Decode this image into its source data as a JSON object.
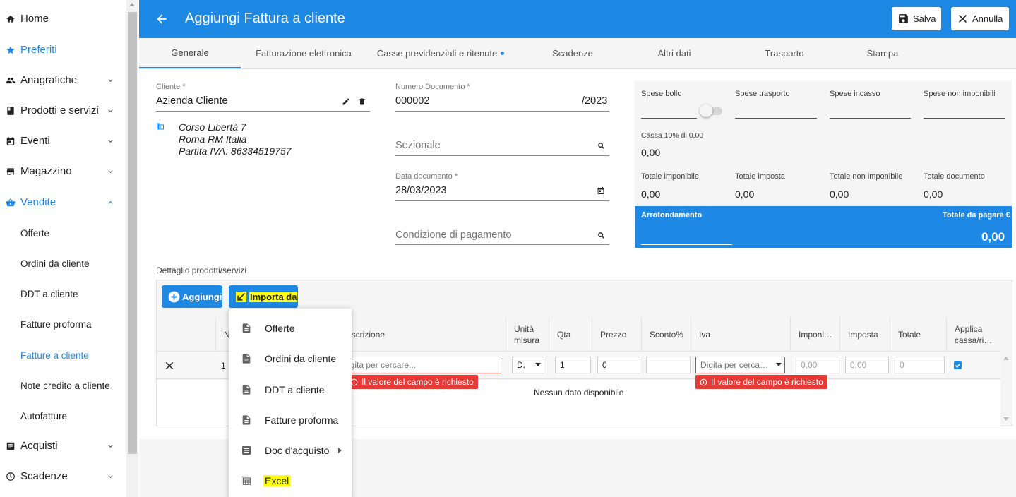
{
  "sidebar": {
    "items": [
      {
        "label": "Home"
      },
      {
        "label": "Preferiti"
      },
      {
        "label": "Anagrafiche"
      },
      {
        "label": "Prodotti e servizi"
      },
      {
        "label": "Eventi"
      },
      {
        "label": "Magazzino"
      },
      {
        "label": "Vendite"
      },
      {
        "label": "Acquisti"
      },
      {
        "label": "Scadenze"
      }
    ],
    "sub_items": [
      {
        "label": "Offerte"
      },
      {
        "label": "Ordini da cliente"
      },
      {
        "label": "DDT a cliente"
      },
      {
        "label": "Fatture proforma"
      },
      {
        "label": "Fatture a cliente"
      },
      {
        "label": "Note credito a cliente"
      },
      {
        "label": "Autofatture"
      }
    ]
  },
  "header": {
    "title": "Aggiungi Fattura a cliente",
    "save_label": "Salva",
    "cancel_label": "Annulla"
  },
  "tabs": [
    {
      "label": "Generale"
    },
    {
      "label": "Fatturazione elettronica"
    },
    {
      "label": "Casse previdenziali e ritenute"
    },
    {
      "label": "Scadenze"
    },
    {
      "label": "Altri dati"
    },
    {
      "label": "Trasporto"
    },
    {
      "label": "Stampa"
    }
  ],
  "form": {
    "cliente_label": "Cliente *",
    "cliente_value": "Azienda Cliente",
    "address_line1": "Corso Libertà 7",
    "address_line2": "Roma RM Italia",
    "address_line3": "Partita IVA: 86334519757",
    "numero_label": "Numero Documento *",
    "numero_value": "000002",
    "numero_suffix": "/2023",
    "sezionale_placeholder": "Sezionale",
    "data_label": "Data documento *",
    "data_value": "28/03/2023",
    "condizione_placeholder": "Condizione di pagamento"
  },
  "totals": {
    "spese_bollo": "Spese bollo",
    "spese_trasporto": "Spese trasporto",
    "spese_incasso": "Spese incasso",
    "spese_non_imponibili": "Spese non imponibili",
    "cassa_label": "Cassa  10% di 0,00",
    "cassa_value": "0,00",
    "totale_imponibile_label": "Totale imponibile",
    "totale_imponibile": "0,00",
    "totale_imposta_label": "Totale imposta",
    "totale_imposta": "0,00",
    "totale_non_imponibile_label": "Totale non imponibile",
    "totale_non_imponibile": "0,00",
    "totale_documento_label": "Totale documento",
    "totale_documento": "0,00",
    "arrotondamento_label": "Arrotondamento",
    "totale_pagare_label": "Totale da pagare €",
    "totale_pagare": "0,00"
  },
  "detail": {
    "section_label": "Dettaglio prodotti/servizi",
    "add_label": "Aggiungi",
    "import_label": "Importa da",
    "columns": {
      "n": "N",
      "descrizione": "escrizione",
      "unita": "Unità misura",
      "qta": "Qta",
      "prezzo": "Prezzo",
      "sconto": "Sconto%",
      "iva": "Iva",
      "imponibile": "Imponi…",
      "imposta": "Imposta",
      "totale": "Totale",
      "applica": "Applica cassa/ri…"
    },
    "row": {
      "n": "1",
      "descrizione_placeholder": "igita per cercare...",
      "unita": "D.",
      "qta": "1",
      "prezzo": "0",
      "sconto": "",
      "iva_placeholder": "Digita per cerca…",
      "imponibile": "0,00",
      "imposta": "0,00",
      "totale": "0"
    },
    "error_text": "Il valore del campo è richiesto",
    "empty_text": "Nessun dato disponibile"
  },
  "import_menu": {
    "items": [
      {
        "label": "Offerte"
      },
      {
        "label": "Ordini da cliente"
      },
      {
        "label": "DDT a cliente"
      },
      {
        "label": "Fatture proforma"
      },
      {
        "label": "Doc d'acquisto"
      },
      {
        "label": "Excel"
      }
    ]
  },
  "colors": {
    "accent": "#1e88e5",
    "error": "#e53935",
    "highlight": "#ffff00"
  }
}
